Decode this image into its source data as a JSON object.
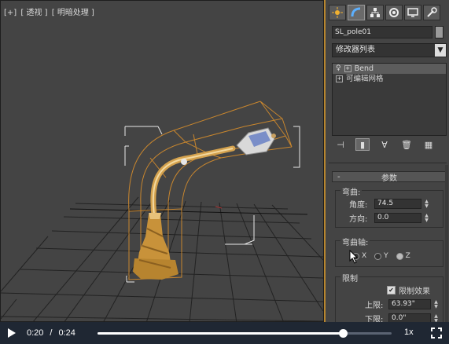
{
  "viewport": {
    "label_plus": "[+]",
    "label_view": "[ 透视 ]",
    "label_shading": "[ 明暗处理 ]"
  },
  "command_panel": {
    "tabs": [
      {
        "icon": "create-icon"
      },
      {
        "icon": "modify-icon"
      },
      {
        "icon": "hierarchy-icon"
      },
      {
        "icon": "motion-icon"
      },
      {
        "icon": "display-icon"
      },
      {
        "icon": "utilities-icon"
      }
    ],
    "object_name": "SL_pole01",
    "modifier_list": "修改器列表",
    "stack": [
      {
        "label": "Bend",
        "selected": true
      },
      {
        "label": "可编辑网格",
        "selected": false
      }
    ],
    "rollout_title": "参数",
    "rollout_minus": "-",
    "bend": {
      "group_label": "弯曲:",
      "angle_label": "角度:",
      "angle_value": "74.5",
      "direction_label": "方向:",
      "direction_value": "0.0"
    },
    "bend_axis": {
      "group_label": "弯曲轴:",
      "x_label": "X",
      "y_label": "Y",
      "z_label": "Z",
      "selected": "Z"
    },
    "limits": {
      "group_label": "限制",
      "effect_label": "限制效果",
      "effect_checked": true,
      "upper_label": "上限:",
      "upper_value": "63.93\"",
      "lower_label": "下限:",
      "lower_value": "0.0\""
    }
  },
  "player": {
    "current_time": "0:20",
    "separator": "/",
    "duration": "0:24",
    "progress": 0.833,
    "speed": "1x"
  }
}
